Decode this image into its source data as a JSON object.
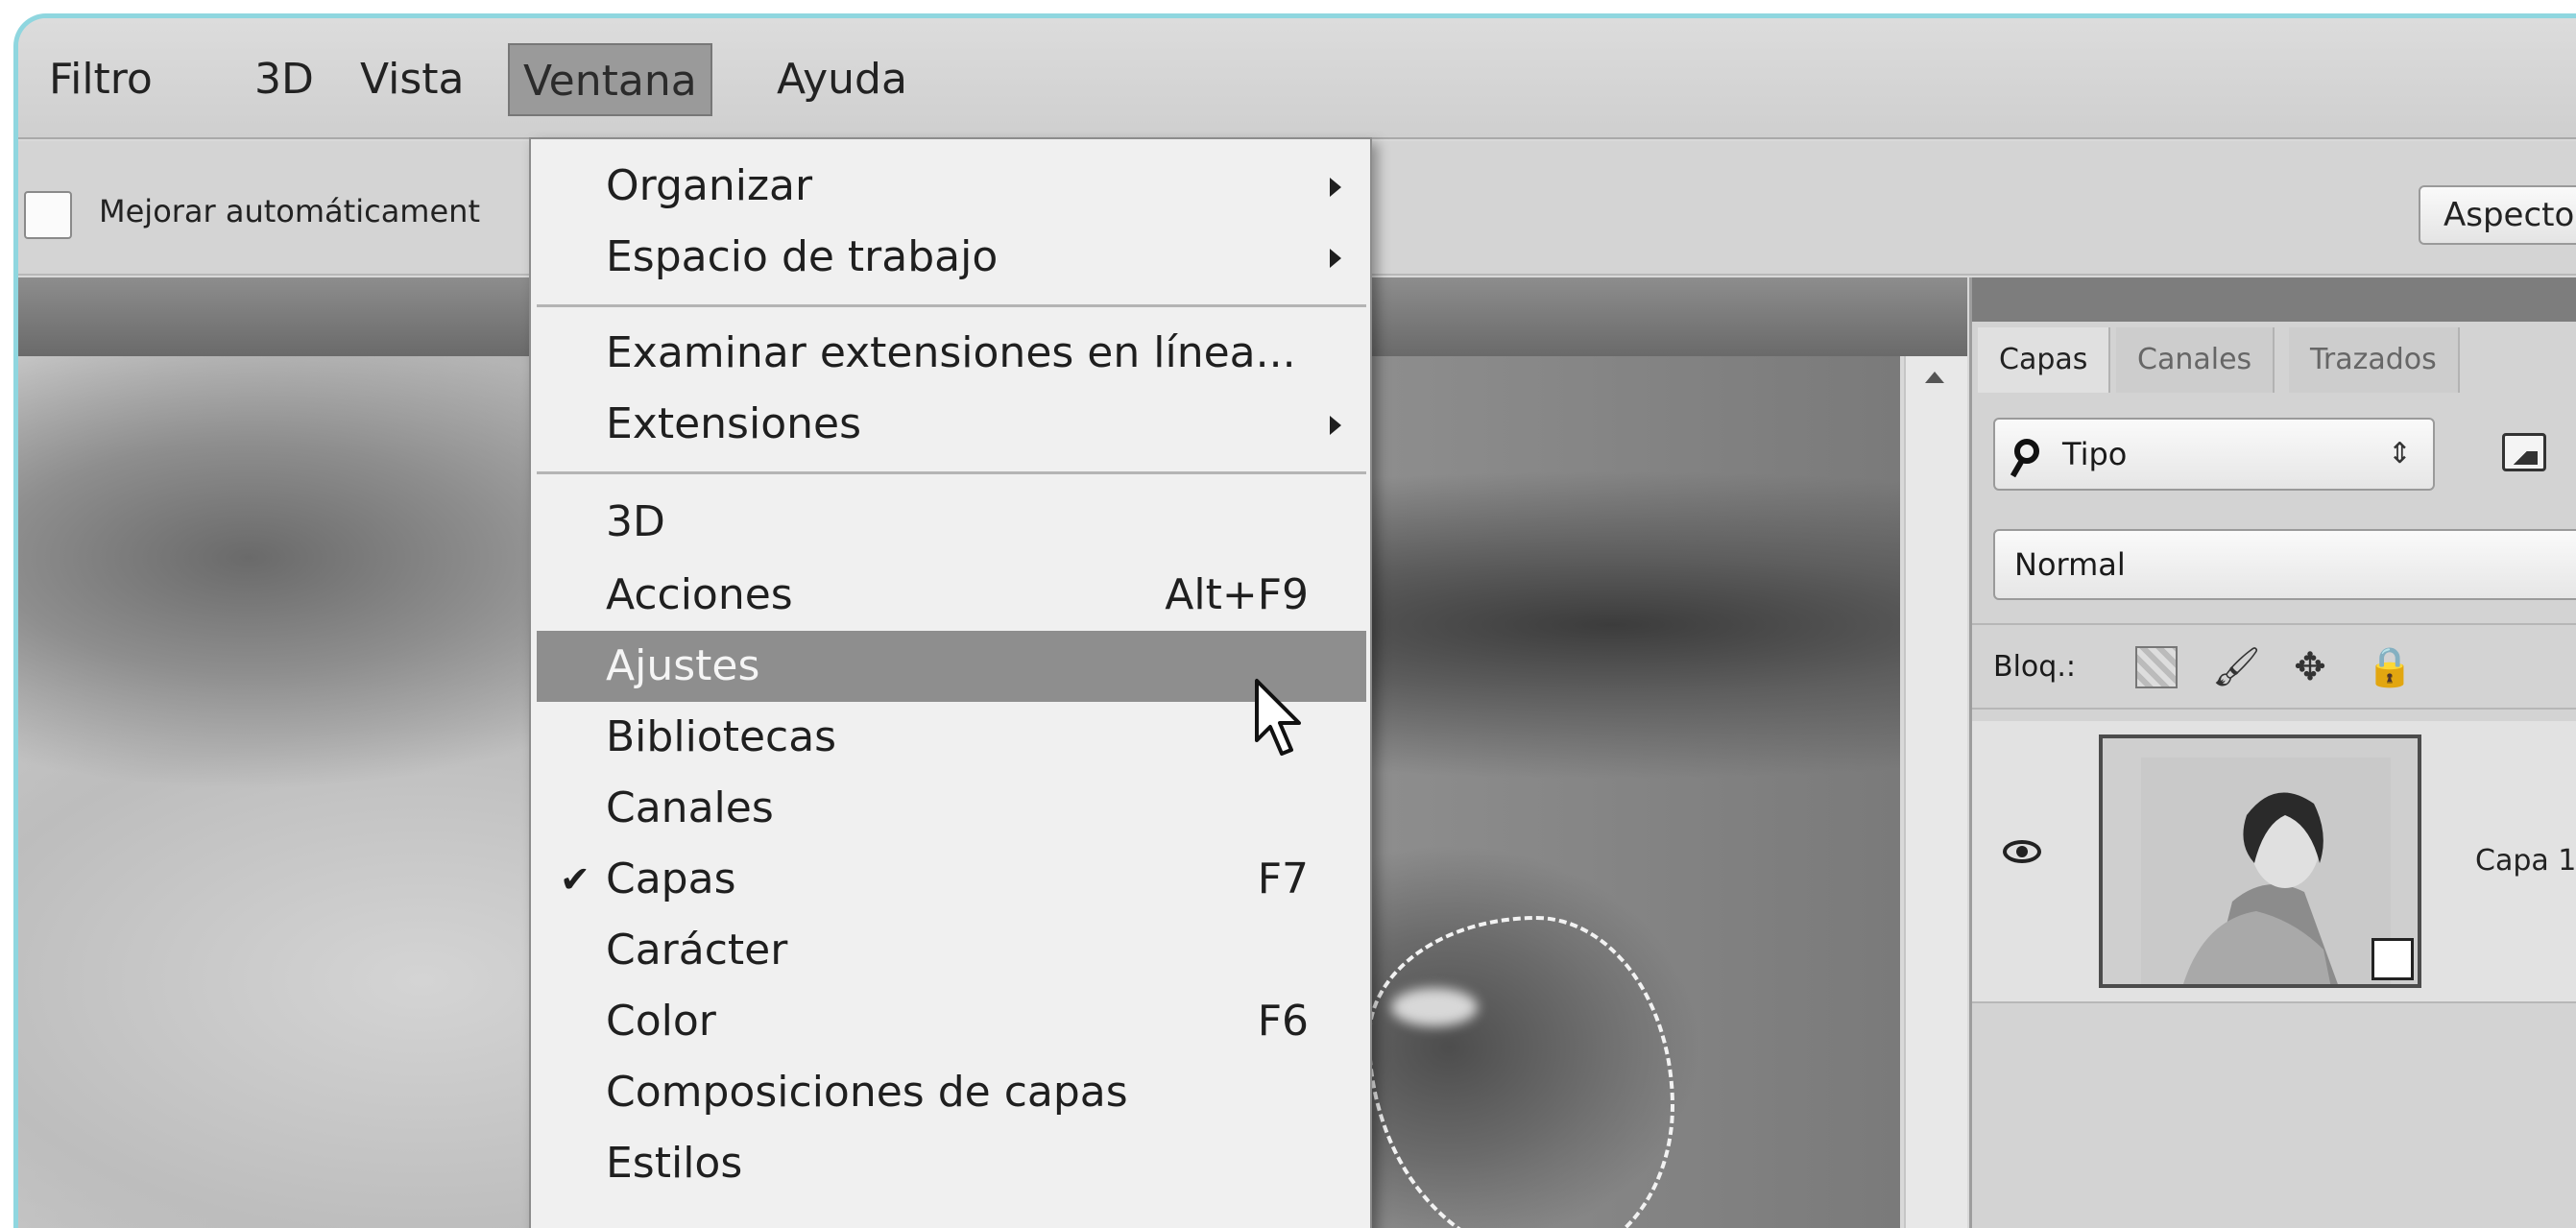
{
  "menubar": {
    "items": [
      {
        "label": "Filtro"
      },
      {
        "label": "3D"
      },
      {
        "label": "Vista"
      },
      {
        "label": "Ventana"
      },
      {
        "label": "Ayuda"
      }
    ]
  },
  "options": {
    "auto_enhance_label": "Mejorar automáticament",
    "aspect_button": "Aspecto"
  },
  "dropdown": {
    "items": [
      {
        "label": "Organizar",
        "submenu": true
      },
      {
        "label": "Espacio de trabajo",
        "submenu": true
      },
      {
        "label": "Examinar extensiones en línea..."
      },
      {
        "label": "Extensiones",
        "submenu": true
      },
      {
        "label": "3D"
      },
      {
        "label": "Acciones",
        "shortcut": "Alt+F9"
      },
      {
        "label": "Ajustes",
        "highlighted": true
      },
      {
        "label": "Bibliotecas"
      },
      {
        "label": "Canales"
      },
      {
        "label": "Capas",
        "shortcut": "F7",
        "checked": true,
        "check": "✔"
      },
      {
        "label": "Carácter"
      },
      {
        "label": "Color",
        "shortcut": "F6"
      },
      {
        "label": "Composiciones de capas"
      },
      {
        "label": "Estilos"
      }
    ]
  },
  "layers_panel": {
    "tabs": [
      {
        "label": "Capas"
      },
      {
        "label": "Canales"
      },
      {
        "label": "Trazados"
      }
    ],
    "filter_label": "Tipo",
    "filter_arrows": "⇕",
    "blend_mode": "Normal",
    "lock_label": "Bloq.:",
    "lock_icons": {
      "brush": "🖌",
      "move": "✥",
      "lock": "🔒"
    },
    "layer_name": "Capa 1"
  }
}
